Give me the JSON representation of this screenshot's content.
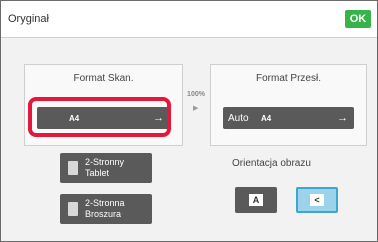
{
  "header": {
    "title": "Oryginał",
    "ok_label": "OK"
  },
  "scan_panel": {
    "label": "Format Skan.",
    "size": "A4",
    "arrow_icon": "arrow-right-icon"
  },
  "ratio": {
    "percent": "100%",
    "arrow_icon": "triangle-right-icon"
  },
  "send_panel": {
    "label": "Format Przesł.",
    "mode": "Auto",
    "size": "A4",
    "arrow_icon": "arrow-right-icon"
  },
  "duplex_buttons": [
    {
      "label": "2-Stronny Tablet",
      "icon": "tablet-icon"
    },
    {
      "label": "2-Stronna Broszura",
      "icon": "booklet-icon"
    }
  ],
  "orientation": {
    "label": "Orientacja obrazu",
    "options": [
      {
        "glyph": "A",
        "selected": false
      },
      {
        "glyph": "<",
        "selected": true
      }
    ]
  },
  "colors": {
    "ok": "#37b34a",
    "highlight": "#e3183b",
    "selected": "#9bd4ea"
  }
}
